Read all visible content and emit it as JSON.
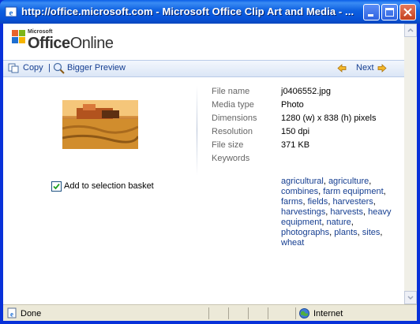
{
  "window": {
    "title": "http://office.microsoft.com - Microsoft Office Clip Art and Media - ...",
    "controls": [
      "minimize",
      "maximize",
      "close"
    ]
  },
  "logo": {
    "microsoft": "Microsoft",
    "office": "Office",
    "online": "Online"
  },
  "toolbar": {
    "copy": "Copy",
    "separator": "|",
    "bigger_preview": "Bigger Preview",
    "next": "Next"
  },
  "checkbox": {
    "label": "Add to selection basket",
    "checked": true
  },
  "properties": [
    {
      "label": "File name",
      "value": "j0406552.jpg"
    },
    {
      "label": "Media type",
      "value": "Photo"
    },
    {
      "label": "Dimensions",
      "value": "1280 (w) x 838 (h) pixels"
    },
    {
      "label": "Resolution",
      "value": "150 dpi"
    },
    {
      "label": "File size",
      "value": "371 KB"
    }
  ],
  "keywords_label": "Keywords",
  "keywords": [
    "agricultural",
    "agriculture",
    "combines",
    "farm equipment",
    "farms",
    "fields",
    "harvesters",
    "harvestings",
    "harvests",
    "heavy equipment",
    "nature",
    "photographs",
    "plants",
    "sites",
    "wheat"
  ],
  "status": {
    "text": "Done",
    "zone": "Internet"
  },
  "colors": {
    "title_bar": "#0a5ee8",
    "link": "#153e91",
    "label_gray": "#666666",
    "statusbar": "#ece9d8"
  }
}
